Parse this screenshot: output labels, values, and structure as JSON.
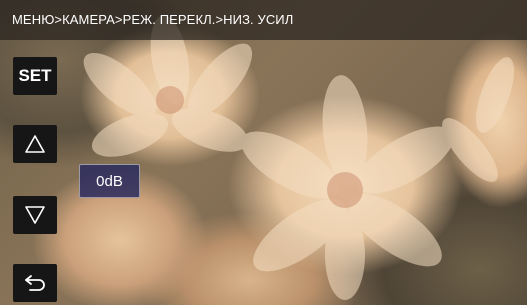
{
  "header": {
    "breadcrumb": "МЕНЮ>КАМЕРА>РЕЖ. ПЕРЕКЛ.>НИЗ. УСИЛ"
  },
  "controls": {
    "set_label": "SET",
    "up_icon": "triangle-up-icon",
    "down_icon": "triangle-down-icon",
    "back_icon": "return-arrow-icon"
  },
  "value": {
    "text": "0dB"
  },
  "colors": {
    "button_bg": "#161616",
    "value_bg": "#2a2a5e",
    "header_bg": "#28221e"
  }
}
